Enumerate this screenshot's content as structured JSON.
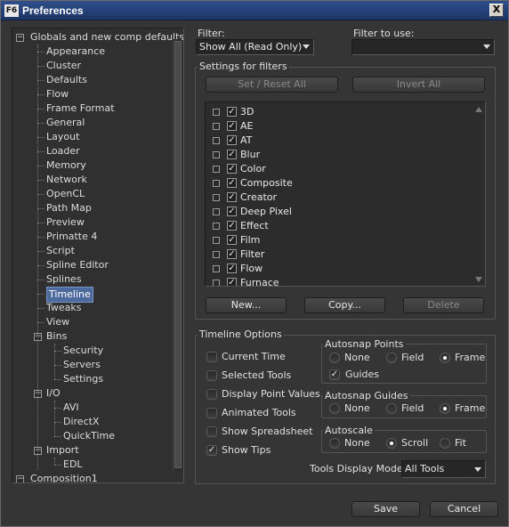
{
  "window": {
    "title": "Preferences",
    "app_icon_text": "F6",
    "close_glyph": "X"
  },
  "tree": {
    "items": [
      {
        "label": "Globals and new comp defaults",
        "level": 0,
        "expander": "−"
      },
      {
        "label": "Appearance",
        "level": 1
      },
      {
        "label": "Cluster",
        "level": 1
      },
      {
        "label": "Defaults",
        "level": 1
      },
      {
        "label": "Flow",
        "level": 1
      },
      {
        "label": "Frame Format",
        "level": 1
      },
      {
        "label": "General",
        "level": 1
      },
      {
        "label": "Layout",
        "level": 1
      },
      {
        "label": "Loader",
        "level": 1
      },
      {
        "label": "Memory",
        "level": 1
      },
      {
        "label": "Network",
        "level": 1
      },
      {
        "label": "OpenCL",
        "level": 1
      },
      {
        "label": "Path Map",
        "level": 1
      },
      {
        "label": "Preview",
        "level": 1
      },
      {
        "label": "Primatte 4",
        "level": 1
      },
      {
        "label": "Script",
        "level": 1
      },
      {
        "label": "Spline Editor",
        "level": 1
      },
      {
        "label": "Splines",
        "level": 1
      },
      {
        "label": "Timeline",
        "level": 1,
        "selected": true
      },
      {
        "label": "Tweaks",
        "level": 1
      },
      {
        "label": "View",
        "level": 1
      },
      {
        "label": "Bins",
        "level": 1,
        "expander": "−"
      },
      {
        "label": "Security",
        "level": 2
      },
      {
        "label": "Servers",
        "level": 2
      },
      {
        "label": "Settings",
        "level": 2
      },
      {
        "label": "I/O",
        "level": 1,
        "expander": "−"
      },
      {
        "label": "AVI",
        "level": 2
      },
      {
        "label": "DirectX",
        "level": 2
      },
      {
        "label": "QuickTime",
        "level": 2
      },
      {
        "label": "Import",
        "level": 1,
        "expander": "−"
      },
      {
        "label": "EDL",
        "level": 2
      },
      {
        "label": "Composition1",
        "level": 0,
        "expander": "−"
      }
    ]
  },
  "filter": {
    "label": "Filter:",
    "value": "Show All (Read Only)"
  },
  "filter_to_use": {
    "label": "Filter to use:",
    "value": ""
  },
  "settings_for_filters": {
    "title": "Settings for filters",
    "set_reset_all": "Set / Reset All",
    "invert_all": "Invert All",
    "items": [
      "3D",
      "AE",
      "AT",
      "Blur",
      "Color",
      "Composite",
      "Creator",
      "Deep Pixel",
      "Effect",
      "Film",
      "Filter",
      "Flow",
      "Furnace"
    ],
    "new_button": "New...",
    "copy_button": "Copy...",
    "delete_button": "Delete"
  },
  "timeline_options": {
    "title": "Timeline Options",
    "checkboxes": [
      {
        "label": "Current Time",
        "checked": false
      },
      {
        "label": "Selected Tools",
        "checked": false
      },
      {
        "label": "Display Point Values",
        "checked": false
      },
      {
        "label": "Animated Tools",
        "checked": false
      },
      {
        "label": "Show Spreadsheet",
        "checked": false
      },
      {
        "label": "Show Tips",
        "checked": true
      }
    ],
    "autosnap_points": {
      "title": "Autosnap Points",
      "options": [
        "None",
        "Field",
        "Frame"
      ],
      "selected": "Frame",
      "guides_label": "Guides",
      "guides_checked": true
    },
    "autosnap_guides": {
      "title": "Autosnap Guides",
      "options": [
        "None",
        "Field",
        "Frame"
      ],
      "selected": "Frame"
    },
    "autoscale": {
      "title": "Autoscale",
      "options": [
        "None",
        "Scroll",
        "Fit"
      ],
      "selected": "Scroll"
    },
    "tools_display_mode": {
      "label": "Tools Display Mode:",
      "value": "All Tools"
    }
  },
  "footer": {
    "save": "Save",
    "cancel": "Cancel"
  },
  "check_glyph": "✓"
}
